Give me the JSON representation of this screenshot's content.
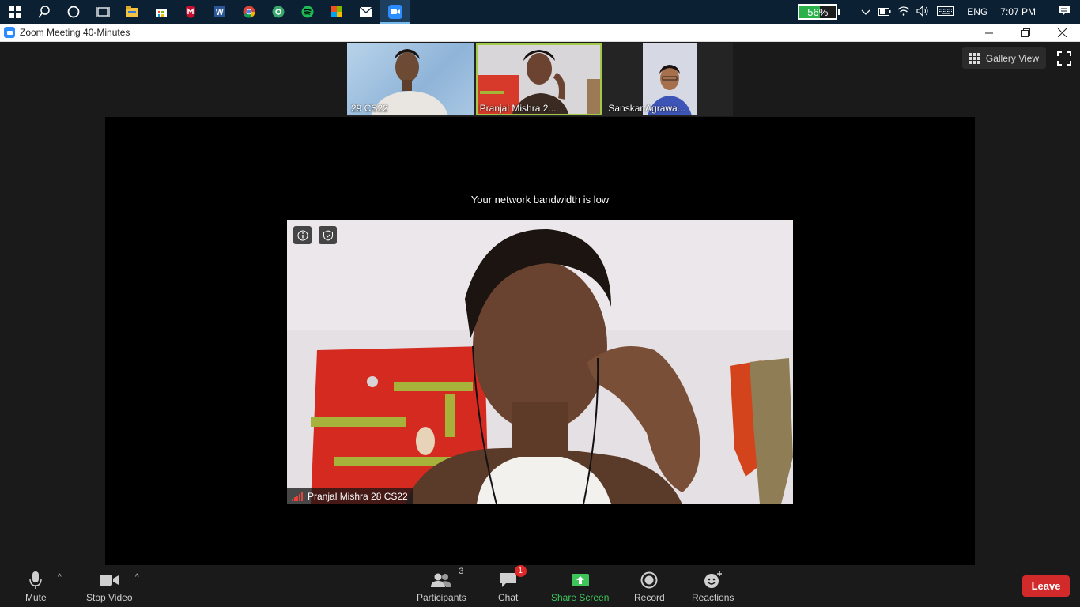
{
  "window": {
    "title": "Zoom Meeting 40-Minutes"
  },
  "taskbar": {
    "icons": [
      "windows-start-icon",
      "search-icon",
      "cortana-icon",
      "task-view-icon",
      "file-explorer-icon",
      "store-icon",
      "mcafee-icon",
      "word-icon",
      "chrome-icon",
      "app-icon",
      "spotify-icon",
      "office-icon",
      "mail-icon",
      "zoom-icon"
    ],
    "battery_percent": "56%",
    "language": "ENG",
    "time": "7:07 PM"
  },
  "thumbnails": [
    {
      "name": "29 CS22"
    },
    {
      "name": "Pranjal Mishra 2..."
    },
    {
      "name": "Sanskar Agrawa..."
    }
  ],
  "view": {
    "gallery_label": "Gallery View"
  },
  "main": {
    "notice": "Your network bandwidth is low",
    "speaker_name": "Pranjal Mishra 28 CS22"
  },
  "toolbar": {
    "mute_label": "Mute",
    "stop_video_label": "Stop Video",
    "participants_label": "Participants",
    "participants_count": "3",
    "chat_label": "Chat",
    "chat_badge": "1",
    "share_label": "Share Screen",
    "record_label": "Record",
    "reactions_label": "Reactions",
    "leave_label": "Leave"
  },
  "colors": {
    "zoom_blue": "#2d8cff",
    "share_green": "#3ec55a",
    "leave_red": "#d22a2a",
    "active_thumb": "#a3c94a"
  }
}
